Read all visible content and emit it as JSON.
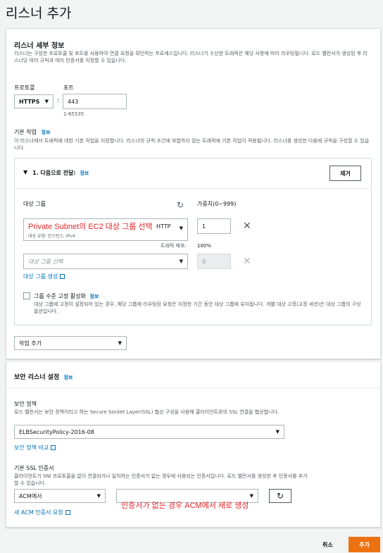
{
  "page": {
    "title": "리스너 추가"
  },
  "details": {
    "heading": "리스너 세부 정보",
    "description": "리스너는 구성한 프로토콜 및 포트를 사용하여 연결 요청을 확인하는 프로세스입니다. 리스너가 수신한 트래픽은 해당 사항에 따라 라우팅됩니다. 로드 밸런서가 생성된 후 리스너당 여러 규칙과 여러 인증서를 지정할 수 있습니다.",
    "protocol_label": "프로토콜",
    "protocol_value": "HTTPS",
    "colon": ":",
    "port_label": "포트",
    "port_value": "443",
    "port_hint": "1-65535",
    "default_action_label": "기본 작업",
    "info": "정보",
    "default_action_desc": "이 리스너에서 트래픽에 대한 기본 작업을 지정합니다. 리스너의 규칙 조건에 부합하지 않는 트래픽에 기본 작업이 적용됩니다. 리스너를 생성한 다음에 규칙을 구성할 수 있습니다."
  },
  "forward": {
    "header": "1. 다음으로 전달:",
    "info": "정보",
    "remove_button": "제거",
    "target_group_label": "대상 그룹",
    "weight_label": "가중치(0~999)",
    "row1": {
      "annotation": "Private Subnet의 EC2 대상 그룹 선택",
      "subtext": "대상 유형: 인스턴스, IPv4",
      "protocol": "HTTP",
      "weight": "1",
      "traffic_label": "트래픽 배포:",
      "traffic_value": "100%"
    },
    "row2": {
      "placeholder": "대상 그룹 선택",
      "weight": "0"
    },
    "create_group_link": "대상 그룹 생성",
    "stickiness_label": "그룹 수준 고정 활성화",
    "stickiness_info": "정보",
    "stickiness_desc": "대상 그룹에 고정이 설정되어 있는 경우, 해당 그룹에 라우팅된 요청은 지정한 기간 동안 대상 그룹에 유지됩니다. 개별 대상 고정(고정 세션)은 대상 그룹의 구성 옵션입니다."
  },
  "add_action": {
    "label": "작업 추가"
  },
  "secure": {
    "heading": "보안 리스너 설정",
    "info": "정보",
    "policy_label": "보안 정책",
    "policy_desc": "로드 밸런서는 보안 정책이라고 하는 Secure Socket Layer(SSL) 협상 구성을 사용해 클라이언트와의 SSL 연결을 협상합니다.",
    "policy_value": "ELBSecurityPolicy-2016-08",
    "compare_link": "보안 정책 비교",
    "ssl_label": "기본 SSL 인증서",
    "ssl_desc": "클라이언트가 SNI 프로토콜을 없이 연결되거나 일치하는 인증서가 없는 경우에 사용되는 인증서입니다. 로드 밸런서를 생성한 후 인증서를 추가할 수 있습니다.",
    "source_value": "ACM에서",
    "cert_annotation": "인증서가 없는 경우 ACM에서 새로 생성",
    "new_cert_link": "새 ACM 인증서 요청"
  },
  "footer": {
    "cancel": "취소",
    "add": "추가"
  },
  "colors": {
    "accent": "#ec7211",
    "link": "#0073bb",
    "annotation": "#e8262a"
  }
}
